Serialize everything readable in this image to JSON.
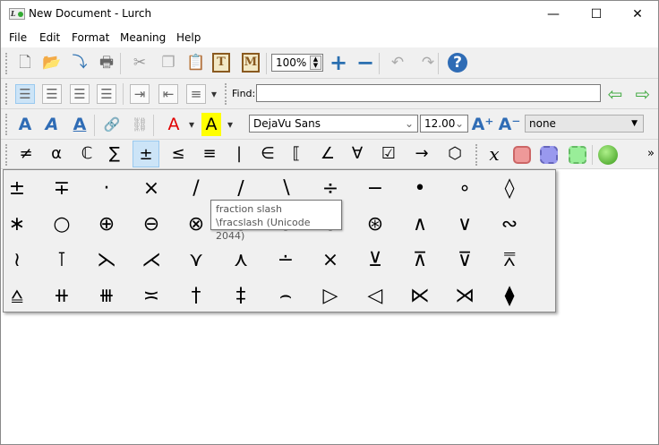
{
  "window": {
    "title": "New Document - Lurch",
    "logo_text": "L",
    "controls": [
      "—",
      "☐",
      "✕"
    ]
  },
  "menubar": [
    "File",
    "Edit",
    "Format",
    "Meaning",
    "Help"
  ],
  "toolbar1": {
    "icons": [
      {
        "name": "new-document-icon",
        "g": "🗋",
        "c": "#777"
      },
      {
        "name": "open-folder-icon",
        "g": "📂",
        "c": "#3a6ea5"
      },
      {
        "name": "save-icon",
        "g": "⤵",
        "c": "#2a6fb0"
      },
      {
        "name": "print-icon",
        "g": "🖶",
        "c": "#666"
      },
      {
        "name": "cut-icon",
        "g": "✂",
        "c": "#999"
      },
      {
        "name": "copy-icon",
        "g": "❐",
        "c": "#aaa"
      },
      {
        "name": "paste-icon",
        "g": "📋",
        "c": "#8a5a20"
      },
      {
        "name": "paste-text-icon",
        "g": "T",
        "c": "#8a5a20"
      },
      {
        "name": "paste-math-icon",
        "g": "M",
        "c": "#8a5a20"
      },
      {
        "name": "zoom-in-icon",
        "g": "+",
        "c": "#2a6fb0"
      },
      {
        "name": "zoom-out-icon",
        "g": "−",
        "c": "#2a6fb0"
      },
      {
        "name": "undo-icon",
        "g": "↶",
        "c": "#aaa"
      },
      {
        "name": "redo-icon",
        "g": "↷",
        "c": "#aaa"
      },
      {
        "name": "help-icon",
        "g": "?",
        "c": "#fff"
      }
    ],
    "zoom_value": "100%"
  },
  "toolbar2": {
    "icons": [
      {
        "name": "align-left-icon",
        "g": "☰"
      },
      {
        "name": "align-center-icon",
        "g": "☰"
      },
      {
        "name": "align-right-icon",
        "g": "☰"
      },
      {
        "name": "justify-icon",
        "g": "☰"
      },
      {
        "name": "indent-icon",
        "g": "⇥"
      },
      {
        "name": "outdent-icon",
        "g": "⇤"
      },
      {
        "name": "numbered-list-icon",
        "g": "≡"
      },
      {
        "name": "list-dropdown-icon",
        "g": "▾"
      }
    ],
    "find_label": "Find:",
    "find_value": "",
    "find_prev": "⇦",
    "find_next": "⇨"
  },
  "toolbar3": {
    "icons": [
      {
        "name": "bold-text-icon",
        "g": "A"
      },
      {
        "name": "italic-text-icon",
        "g": "A"
      },
      {
        "name": "underline-text-icon",
        "g": "A"
      },
      {
        "name": "link-icon",
        "g": "🔗"
      },
      {
        "name": "unlink-icon",
        "g": "⛓"
      },
      {
        "name": "text-color-icon",
        "g": "A"
      },
      {
        "name": "text-color-dropdown-icon",
        "g": "▾"
      },
      {
        "name": "highlight-color-icon",
        "g": "A"
      },
      {
        "name": "highlight-dropdown-icon",
        "g": "▾"
      },
      {
        "name": "increase-font-icon",
        "g": "A⁺"
      },
      {
        "name": "decrease-font-icon",
        "g": "A⁻"
      }
    ],
    "font": "DejaVu Sans",
    "size": "12.00",
    "style": "none",
    "text_color": "#e00000",
    "highlight_color": "#ffff00"
  },
  "toolbar4": {
    "symbols": [
      "≠",
      "α",
      "ℂ",
      "∑",
      "±",
      "≤",
      "≡",
      "|",
      "∈",
      "⟦",
      "∠",
      "∀",
      "☑",
      "→",
      "⬡"
    ],
    "selected": 4,
    "extras": [
      {
        "name": "math-variable-icon",
        "g": "x"
      },
      {
        "name": "red-bubble-icon",
        "g": ""
      },
      {
        "name": "blue-bubble-icon",
        "g": ""
      },
      {
        "name": "green-bubble-icon",
        "g": ""
      },
      {
        "name": "green-ball-icon",
        "g": ""
      },
      {
        "name": "more-icon",
        "g": "»"
      }
    ]
  },
  "symbol_palette": [
    [
      "±",
      "∓",
      "·",
      "×",
      "/",
      "∕",
      "∖",
      "÷",
      "−",
      "•",
      "∘",
      "◊"
    ],
    [
      "∗",
      "○",
      "⊕",
      "⊖",
      "⊗",
      "⊘",
      "⊙",
      "⊚",
      "⊛",
      "∧",
      "∨",
      "∾"
    ],
    [
      "≀",
      "⊺",
      "⋋",
      "⋌",
      "⋎",
      "⋏",
      "∸",
      "⨯",
      "⊻",
      "⊼",
      "⊽",
      "⩞"
    ],
    [
      "⩠",
      "⧺",
      "⧻",
      "≍",
      "†",
      "‡",
      "⌢",
      "▷",
      "◁",
      "⋉",
      "⋊",
      "⧫"
    ]
  ],
  "tooltip": {
    "line1": "fraction slash",
    "line2": "\\fracslash (Unicode 2044)"
  }
}
